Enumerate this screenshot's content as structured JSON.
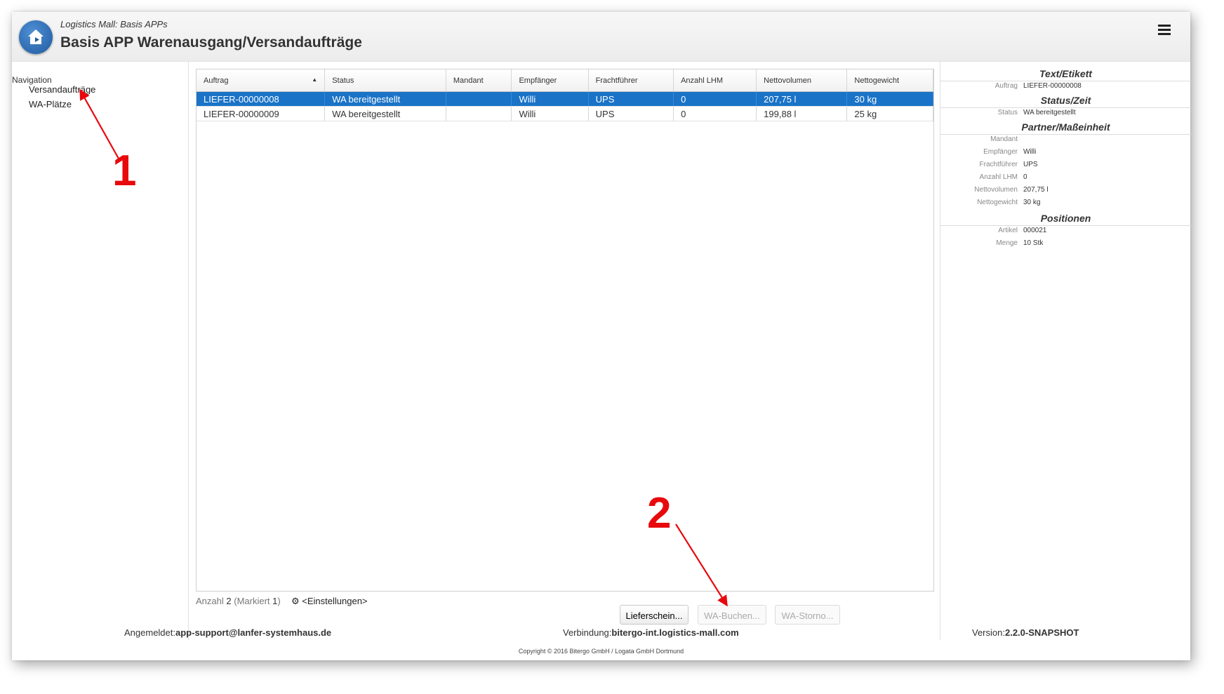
{
  "header": {
    "subtitle": "Logistics Mall: Basis APPs",
    "title": "Basis APP Warenausgang/Versandaufträge"
  },
  "nav": {
    "heading": "Navigation",
    "items": [
      "Versandaufträge",
      "WA-Plätze"
    ]
  },
  "table": {
    "columns": [
      "Auftrag",
      "Status",
      "Mandant",
      "Empfänger",
      "Frachtführer",
      "Anzahl LHM",
      "Nettovolumen",
      "Nettogewicht"
    ],
    "rows": [
      {
        "auftrag": "LIEFER-00000008",
        "status": "WA bereitgestellt",
        "mandant": "",
        "empfaenger": "Willi",
        "frachtfuehrer": "UPS",
        "anzahl": "0",
        "volumen": "207,75 l",
        "gewicht": "30 kg",
        "selected": true
      },
      {
        "auftrag": "LIEFER-00000009",
        "status": "WA bereitgestellt",
        "mandant": "",
        "empfaenger": "Willi",
        "frachtfuehrer": "UPS",
        "anzahl": "0",
        "volumen": "199,88 l",
        "gewicht": "25 kg",
        "selected": false
      }
    ]
  },
  "status": {
    "anzahl_label": "Anzahl",
    "anzahl": "2",
    "markiert_label": "(Markiert",
    "markiert": "1",
    "markiert_close": ")",
    "settings": "<Einstellungen>"
  },
  "buttons": {
    "lieferschein": "Lieferschein...",
    "wa_buchen": "WA-Buchen...",
    "wa_storno": "WA-Storno..."
  },
  "details": {
    "sections": {
      "text": "Text/Etikett",
      "status": "Status/Zeit",
      "partner": "Partner/Maßeinheit",
      "positionen": "Positionen"
    },
    "fields": {
      "auftrag": {
        "label": "Auftrag",
        "value": "LIEFER-00000008"
      },
      "status": {
        "label": "Status",
        "value": "WA bereitgestellt"
      },
      "mandant": {
        "label": "Mandant",
        "value": ""
      },
      "empfaenger": {
        "label": "Empfänger",
        "value": "Willi"
      },
      "frachtfuehrer": {
        "label": "Frachtführer",
        "value": "UPS"
      },
      "anzahl": {
        "label": "Anzahl LHM",
        "value": "0"
      },
      "volumen": {
        "label": "Nettovolumen",
        "value": "207,75 l"
      },
      "gewicht": {
        "label": "Nettogewicht",
        "value": "30 kg"
      },
      "artikel": {
        "label": "Artikel",
        "value": "000021"
      },
      "menge": {
        "label": "Menge",
        "value": "10 Stk"
      }
    }
  },
  "footer": {
    "login_label": "Angemeldet:",
    "login_value": "app-support@lanfer-systemhaus.de",
    "conn_label": "Verbindung:",
    "conn_value": "bitergo-int.logistics-mall.com",
    "version_label": "Version:",
    "version_value": "2.2.0-SNAPSHOT",
    "copyright": "Copyright © 2016 Bitergo GmbH / Logata GmbH Dortmund"
  },
  "annotations": {
    "one": "1",
    "two": "2",
    "color": "#e8090d"
  },
  "colors": {
    "selection": "#1a73c7",
    "logo": "#1f5aa0"
  }
}
